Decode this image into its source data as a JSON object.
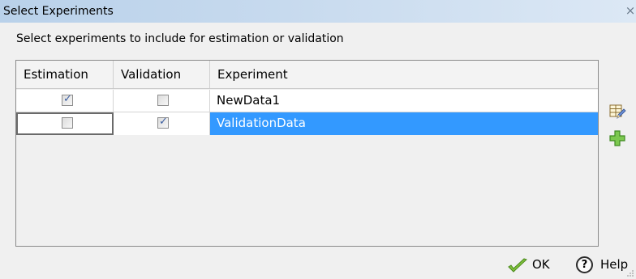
{
  "window": {
    "title": "Select Experiments",
    "close_symbol": "×"
  },
  "instruction": "Select experiments to include for estimation or validation",
  "table": {
    "columns": [
      "Estimation",
      "Validation",
      "Experiment"
    ],
    "rows": [
      {
        "estimation": true,
        "validation": false,
        "experiment": "NewData1",
        "selected": false
      },
      {
        "estimation": false,
        "validation": true,
        "experiment": "ValidationData",
        "selected": true
      }
    ]
  },
  "side_buttons": {
    "edit_icon": "edit-table-icon",
    "add_icon": "add-plus-icon"
  },
  "buttons": {
    "ok_label": "OK",
    "help_label": "Help",
    "help_symbol": "?"
  },
  "checkmark": "✓",
  "colors": {
    "selection": "#3399ff",
    "titlebar": "#b9d1ea",
    "check": "#3c5ea0",
    "add_icon": "#5fb336"
  }
}
